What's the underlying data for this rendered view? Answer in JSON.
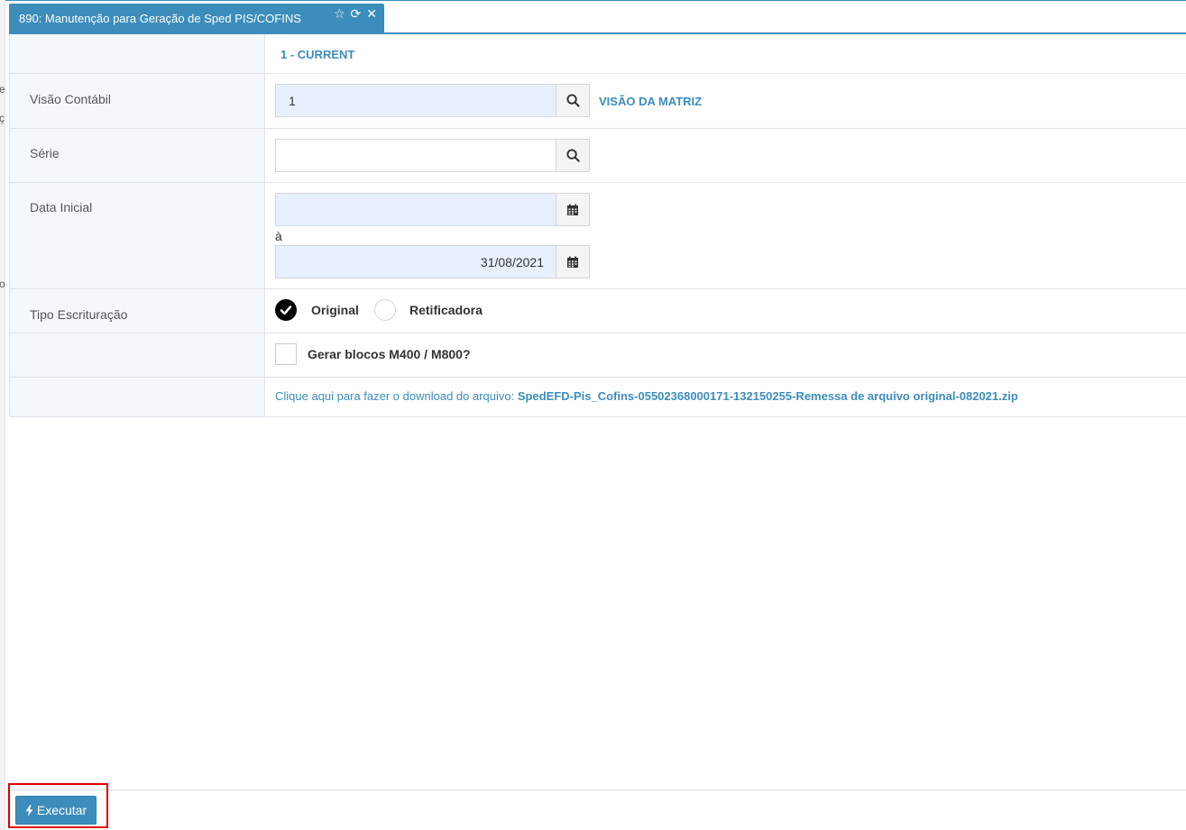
{
  "tab": {
    "title": "890: Manutenção para Geração de Sped PIS/COFINS"
  },
  "left_edge": {
    "chars": [
      "e",
      "ç",
      "o"
    ]
  },
  "header_row": {
    "value": "1 - CURRENT"
  },
  "visao_contabil": {
    "label": "Visão Contábil",
    "value": "1",
    "link": "VISÃO DA MATRIZ"
  },
  "serie": {
    "label": "Série",
    "value": ""
  },
  "data_inicial": {
    "label": "Data Inicial",
    "from_value": "",
    "separator": "à",
    "to_value": "31/08/2021"
  },
  "tipo_escrituracao": {
    "label": "Tipo Escrituração",
    "options": [
      {
        "label": "Original",
        "checked": true
      },
      {
        "label": "Retificadora",
        "checked": false
      }
    ]
  },
  "gerar_blocos": {
    "label": "Gerar blocos M400 / M800?",
    "checked": false
  },
  "download": {
    "prefix": "Clique aqui para fazer o download do arquivo:",
    "filename": "SpedEFD-Pis_Cofins-05502368000171-132150255-Remessa de arquivo original-082021.zip"
  },
  "footer": {
    "execute_label": "Executar"
  },
  "colors": {
    "primary": "#3c8dbc",
    "label_bg": "#f5f8fb",
    "highlight": "#e00000"
  }
}
